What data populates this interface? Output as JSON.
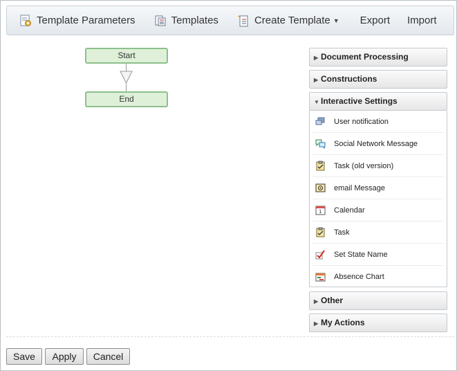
{
  "toolbar": {
    "template_parameters": "Template Parameters",
    "templates": "Templates",
    "create_template": "Create Template",
    "export": "Export",
    "import": "Import"
  },
  "flow": {
    "start": "Start",
    "end": "End"
  },
  "panel": {
    "sections": [
      {
        "label": "Document Processing",
        "expanded": false
      },
      {
        "label": "Constructions",
        "expanded": false
      },
      {
        "label": "Interactive Settings",
        "expanded": true
      },
      {
        "label": "Other",
        "expanded": false
      },
      {
        "label": "My Actions",
        "expanded": false
      }
    ],
    "interactive_items": [
      {
        "label": "User notification",
        "icon": "user-notification-icon"
      },
      {
        "label": "Social Network Message",
        "icon": "social-message-icon"
      },
      {
        "label": "Task (old version)",
        "icon": "task-clipboard-icon"
      },
      {
        "label": "email Message",
        "icon": "email-icon"
      },
      {
        "label": "Calendar",
        "icon": "calendar-icon"
      },
      {
        "label": "Task",
        "icon": "task-clipboard-icon"
      },
      {
        "label": "Set State Name",
        "icon": "checkmark-icon"
      },
      {
        "label": "Absence Chart",
        "icon": "absence-chart-icon"
      }
    ]
  },
  "buttons": {
    "save": "Save",
    "apply": "Apply",
    "cancel": "Cancel"
  }
}
